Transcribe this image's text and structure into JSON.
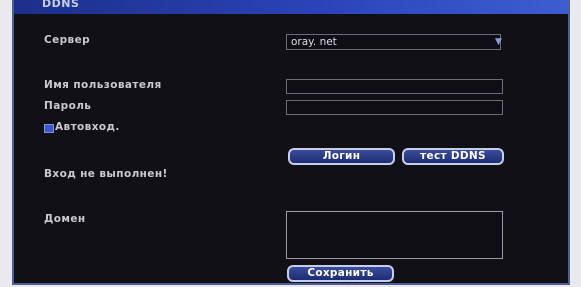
{
  "window": {
    "title": "DDNS"
  },
  "server": {
    "label": "Сервер",
    "value": "oray. net"
  },
  "username": {
    "label": "Имя пользователя",
    "value": ""
  },
  "password": {
    "label": "Пароль",
    "value": ""
  },
  "autologin": {
    "label": "Автовход.",
    "checked": true
  },
  "buttons": {
    "login": "Логин",
    "test": "тест DDNS",
    "save": "Сохранить"
  },
  "status": {
    "text": "Вход не выполнен!"
  },
  "domain": {
    "label": "Домен",
    "value": ""
  },
  "colors": {
    "accent": "#2a44b8",
    "background": "#111015",
    "button": "#1d2c73"
  }
}
